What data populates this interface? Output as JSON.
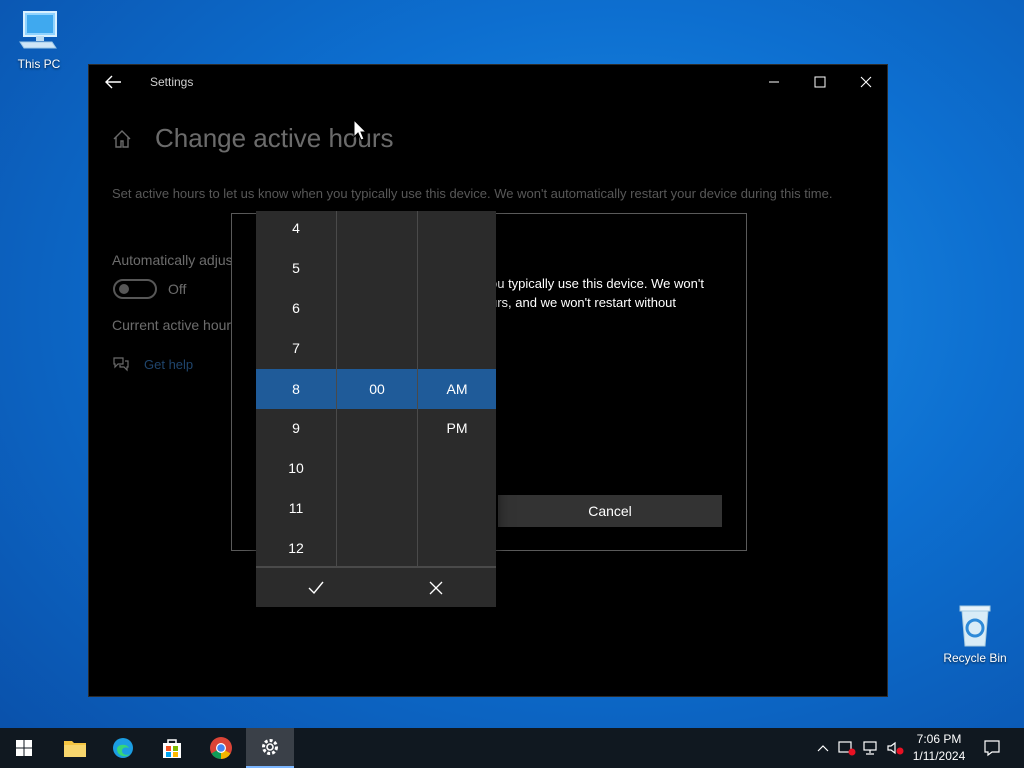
{
  "desktop": {
    "icons": [
      {
        "label": "This PC"
      },
      {
        "label": "Recycle Bin"
      }
    ]
  },
  "window": {
    "app_title": "Settings",
    "page_title": "Change active hours",
    "description": "Set active hours to let us know when you typically use this device. We won't automatically restart your device during this time.",
    "auto_adjust_label": "Automatically adjus",
    "toggle_state": "Off",
    "current_hours_label": "Current active hour",
    "get_help": "Get help"
  },
  "dialog": {
    "text_line1": "ou typically use this device. We won't",
    "text_line2": "urs, and we won't restart without",
    "cancel_label": "Cancel"
  },
  "picker": {
    "hours": [
      "4",
      "5",
      "6",
      "7",
      "8",
      "9",
      "10",
      "11",
      "12"
    ],
    "selected_hour": "8",
    "minute": "00",
    "ampm": [
      "AM",
      "PM"
    ],
    "selected_ampm": "AM"
  },
  "taskbar": {
    "time": "7:06 PM",
    "date": "1/11/2024"
  },
  "colors": {
    "accent": "#1f5b99",
    "link": "#4aa3ff"
  }
}
